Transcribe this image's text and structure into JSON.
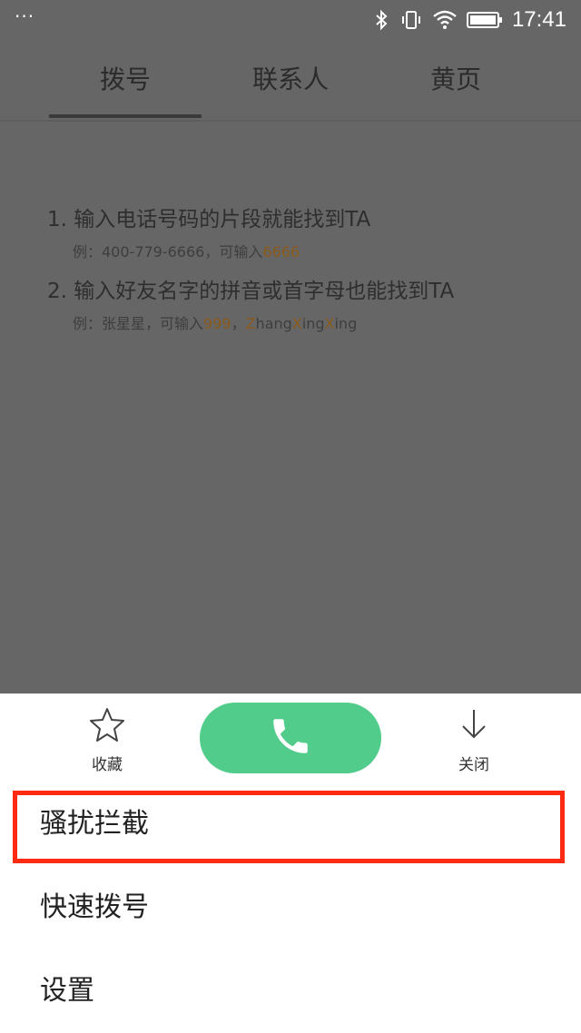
{
  "status_bar": {
    "menu_dots": "···",
    "time": "17:41"
  },
  "tabs": [
    {
      "label": "拨号",
      "active": true
    },
    {
      "label": "联系人",
      "active": false
    },
    {
      "label": "黄页",
      "active": false
    }
  ],
  "hints": {
    "hint1": {
      "title": "1. 输入电话号码的片段就能找到TA",
      "sub_prefix": "例：400-779-6666，可输入",
      "sub_highlight": "6666"
    },
    "hint2": {
      "title": "2. 输入好友名字的拼音或首字母也能找到TA",
      "sub_prefix": "例：张星星，可输入",
      "sub_num": "999",
      "sub_sep": "，",
      "pinyin": [
        {
          "text": "Z",
          "hl": true
        },
        {
          "text": "hang",
          "hl": false
        },
        {
          "text": "X",
          "hl": true
        },
        {
          "text": "ing",
          "hl": false
        },
        {
          "text": "X",
          "hl": true
        },
        {
          "text": "ing",
          "hl": false
        }
      ]
    }
  },
  "sheet": {
    "favorite_label": "收藏",
    "close_label": "关闭",
    "menu": {
      "block": "骚扰拦截",
      "speed_dial": "快速拨号",
      "settings": "设置"
    }
  },
  "colors": {
    "call_green": "#52cc8a",
    "highlight_red": "#ff2a12",
    "hint_orange": "#8a5a1a"
  }
}
